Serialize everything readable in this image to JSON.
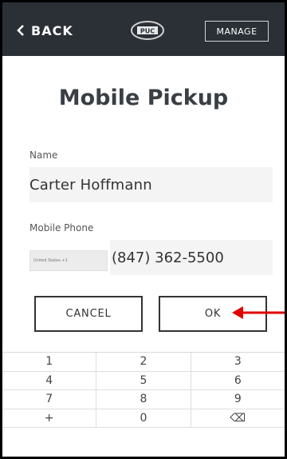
{
  "header": {
    "back_label": "BACK",
    "logo_text": "PUC",
    "manage_label": "MANAGE"
  },
  "page": {
    "title": "Mobile Pickup"
  },
  "form": {
    "name_label": "Name",
    "name_value": "Carter Hoffmann",
    "phone_label": "Mobile Phone",
    "country_value": "United States +1",
    "phone_value": "(847) 362-5500"
  },
  "actions": {
    "cancel_label": "CANCEL",
    "ok_label": "OK"
  },
  "keypad": {
    "rows": [
      [
        "1",
        "2",
        "3"
      ],
      [
        "4",
        "5",
        "6"
      ],
      [
        "7",
        "8",
        "9"
      ],
      [
        "+",
        "0",
        "⌫"
      ]
    ]
  },
  "colors": {
    "header_bg": "#2b3036",
    "annotation_arrow": "#e00000"
  }
}
